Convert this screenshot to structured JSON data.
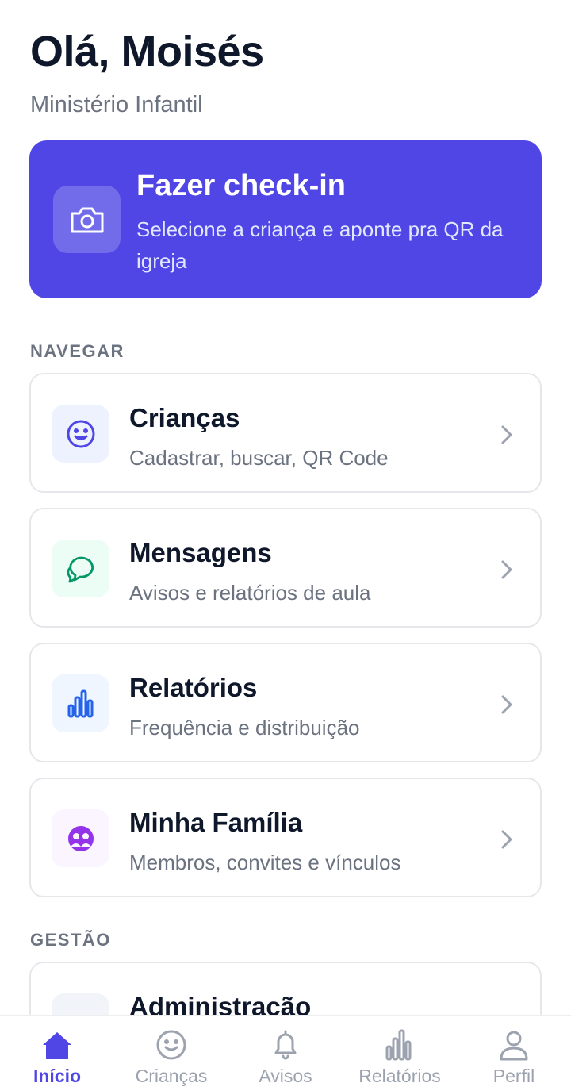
{
  "header": {
    "greeting": "Olá, Moisés",
    "subtitle": "Ministério Infantil"
  },
  "checkin": {
    "icon": "camera-icon",
    "title": "Fazer check-in",
    "description": "Selecione a criança e aponte pra QR da igreja",
    "color": "#4f46e5"
  },
  "sections": {
    "navegar": "NAVEGAR",
    "gestao": "GESTÃO"
  },
  "menu": [
    {
      "title": "Crianças",
      "description": "Cadastrar, buscar, QR Code",
      "icon": "smiley-icon",
      "color": "#4f46e5"
    },
    {
      "title": "Mensagens",
      "description": "Avisos e relatórios de aula",
      "icon": "chat-bubbles-icon",
      "color": "#059669"
    },
    {
      "title": "Relatórios",
      "description": "Frequência e distribuição",
      "icon": "bar-chart-icon",
      "color": "#2563eb"
    },
    {
      "title": "Minha Família",
      "description": "Membros, convites e vínculos",
      "icon": "family-icon",
      "color": "#9333ea"
    }
  ],
  "gestao_items": [
    {
      "title": "Administração"
    }
  ],
  "bottom_nav": [
    {
      "label": "Início",
      "icon": "home-icon",
      "active": true
    },
    {
      "label": "Crianças",
      "icon": "smiley-icon",
      "active": false
    },
    {
      "label": "Avisos",
      "icon": "bell-icon",
      "active": false
    },
    {
      "label": "Relatórios",
      "icon": "bar-chart-icon",
      "active": false
    },
    {
      "label": "Perfil",
      "icon": "user-icon",
      "active": false
    }
  ]
}
